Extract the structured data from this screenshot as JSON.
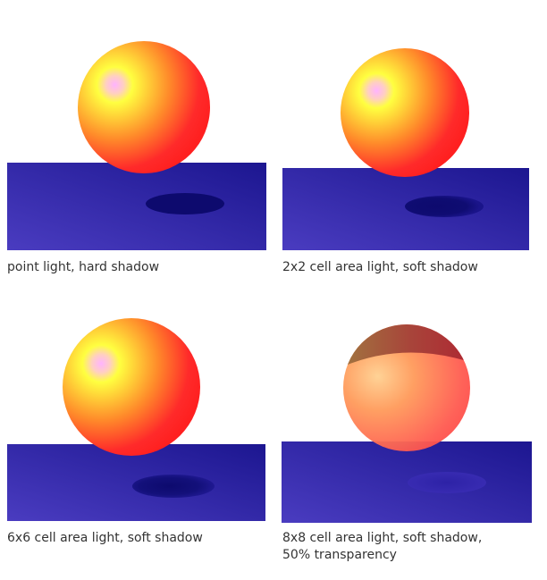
{
  "colors": {
    "floor_left": "#4a3cc0",
    "floor_right": "#1c1690",
    "sphere_highlight": "#ffb3ff",
    "sphere_light": "#ffff40",
    "sphere_mid": "#ff9a30",
    "sphere_dark": "#ff2a2a",
    "shadow": "#0d0a6e",
    "caption_text": "#333333"
  },
  "panels": [
    {
      "name": "point-light-hard-shadow",
      "caption_lines": [
        "point light, hard shadow"
      ],
      "shadow_style": "hard",
      "transparent": false
    },
    {
      "name": "area-light-2x2",
      "caption_lines": [
        "2x2 cell area light, soft shadow"
      ],
      "shadow_style": "soft",
      "transparent": false
    },
    {
      "name": "area-light-6x6",
      "caption_lines": [
        "6x6 cell area light, soft shadow"
      ],
      "shadow_style": "soft",
      "transparent": false
    },
    {
      "name": "area-light-8x8-transparent",
      "caption_lines": [
        "8x8 cell area light, soft shadow,",
        "50% transparency"
      ],
      "shadow_style": "soft",
      "transparent": true,
      "transparency": 0.5
    }
  ]
}
